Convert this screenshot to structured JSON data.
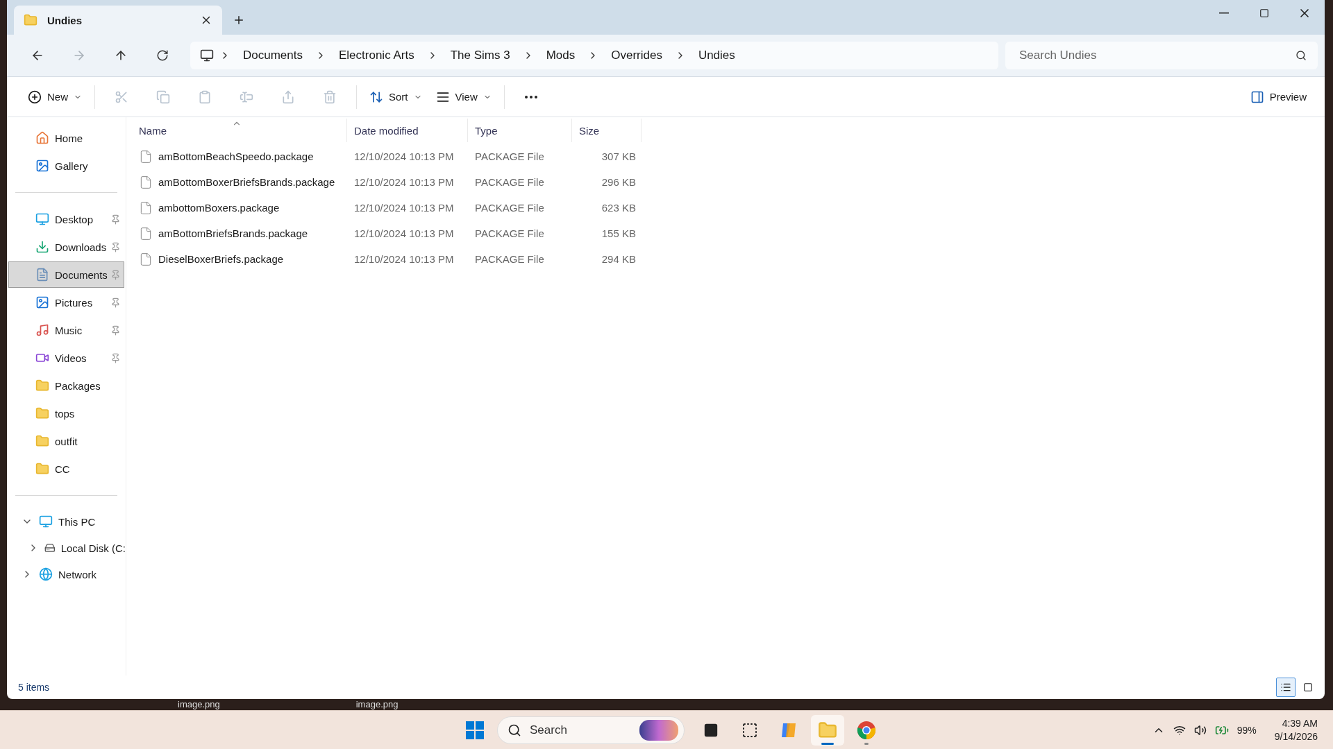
{
  "window": {
    "tab": {
      "title": "Undies",
      "selected": true
    }
  },
  "address_bar": {
    "breadcrumbs": [
      "Documents",
      "Electronic Arts",
      "The Sims 3",
      "Mods",
      "Overrides",
      "Undies"
    ]
  },
  "search": {
    "placeholder": "Search Undies"
  },
  "toolbar": {
    "new": "New",
    "actions": [
      {
        "kind": "cut",
        "disabled": true
      },
      {
        "kind": "copy",
        "disabled": true
      },
      {
        "kind": "paste",
        "disabled": true
      },
      {
        "kind": "rename",
        "disabled": true
      },
      {
        "kind": "share",
        "disabled": true
      },
      {
        "kind": "delete",
        "disabled": true
      }
    ],
    "sort": "Sort",
    "view": "View",
    "preview": "Preview"
  },
  "sidebar": {
    "top": [
      {
        "label": "Home",
        "kind": "home",
        "pinned": false,
        "selected": false
      },
      {
        "label": "Gallery",
        "kind": "gallery",
        "pinned": false,
        "selected": false
      }
    ],
    "quick": [
      {
        "label": "Desktop",
        "kind": "desktop",
        "pinned": true,
        "selected": false
      },
      {
        "label": "Downloads",
        "kind": "downloads",
        "pinned": true,
        "selected": false
      },
      {
        "label": "Documents",
        "kind": "documents",
        "pinned": true,
        "selected": true
      },
      {
        "label": "Pictures",
        "kind": "pictures",
        "pinned": true,
        "selected": false
      },
      {
        "label": "Music",
        "kind": "music",
        "pinned": true,
        "selected": false
      },
      {
        "label": "Videos",
        "kind": "videos",
        "pinned": true,
        "selected": false
      },
      {
        "label": "Packages",
        "kind": "folder",
        "pinned": false,
        "selected": false
      },
      {
        "label": "tops",
        "kind": "folder",
        "pinned": false,
        "selected": false
      },
      {
        "label": "outfit",
        "kind": "folder",
        "pinned": false,
        "selected": false
      },
      {
        "label": "CC",
        "kind": "folder",
        "pinned": false,
        "selected": false
      }
    ],
    "tree": [
      {
        "label": "This PC",
        "kind": "pc",
        "expanded": true,
        "children": [
          {
            "label": "Local Disk (C:",
            "kind": "disk",
            "expanded": false
          }
        ]
      },
      {
        "label": "Network",
        "kind": "network",
        "expanded": false
      }
    ]
  },
  "table": {
    "columns": [
      "Name",
      "Date modified",
      "Type",
      "Size"
    ],
    "rows": [
      [
        "amBottomBeachSpeedo.package",
        "12/10/2024 10:13 PM",
        "PACKAGE File",
        "307 KB"
      ],
      [
        "amBottomBoxerBriefsBrands.package",
        "12/10/2024 10:13 PM",
        "PACKAGE File",
        "296 KB"
      ],
      [
        "ambottomBoxers.package",
        "12/10/2024 10:13 PM",
        "PACKAGE File",
        "623 KB"
      ],
      [
        "amBottomBriefsBrands.package",
        "12/10/2024 10:13 PM",
        "PACKAGE File",
        "155 KB"
      ],
      [
        "DieselBoxerBriefs.package",
        "12/10/2024 10:13 PM",
        "PACKAGE File",
        "294 KB"
      ]
    ]
  },
  "status_bar": {
    "count": "5 items",
    "view_modes": [
      {
        "kind": "details",
        "selected": true
      },
      {
        "kind": "tiles",
        "selected": false
      }
    ]
  },
  "desktop": {
    "labels": [
      "image.png",
      "image.png"
    ]
  },
  "taskbar": {
    "search": "Search",
    "apps": [
      {
        "kind": "taskview",
        "running": false
      },
      {
        "kind": "chatgpt",
        "running": false
      },
      {
        "kind": "copilot",
        "running": false
      },
      {
        "kind": "explorer",
        "running": true
      },
      {
        "kind": "chrome",
        "running": true
      }
    ],
    "battery": "99%",
    "time": "4:39 AM",
    "date": "9/14/2026"
  }
}
